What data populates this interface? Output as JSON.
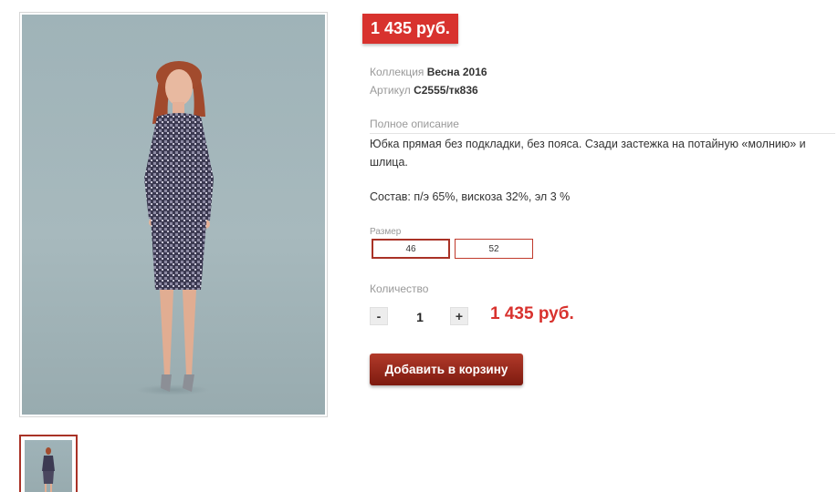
{
  "product": {
    "price_badge": "1 435 руб.",
    "collection_label": "Коллекция",
    "collection_value": "Весна 2016",
    "sku_label": "Артикул",
    "sku_value": "C2555/тк836",
    "description_title": "Полное описание",
    "description_text": "Юбка прямая без подкладки, без пояса. Сзади застежка на потайную «молнию» и шлица.",
    "composition_text": "Состав: п/э 65%, вискоза 32%, эл 3 %"
  },
  "size": {
    "label": "Размер",
    "options": [
      "46",
      "52"
    ],
    "selected": "46"
  },
  "quantity": {
    "label": "Количество",
    "minus": "-",
    "value": "1",
    "plus": "+",
    "total": "1 435 руб."
  },
  "cart": {
    "add_label": "Добавить в корзину"
  },
  "colors": {
    "accent_red": "#d8322e",
    "button_dark_red": "#8b2316",
    "size_border": "#c0392b",
    "photo_background": "#a2b5b9"
  }
}
